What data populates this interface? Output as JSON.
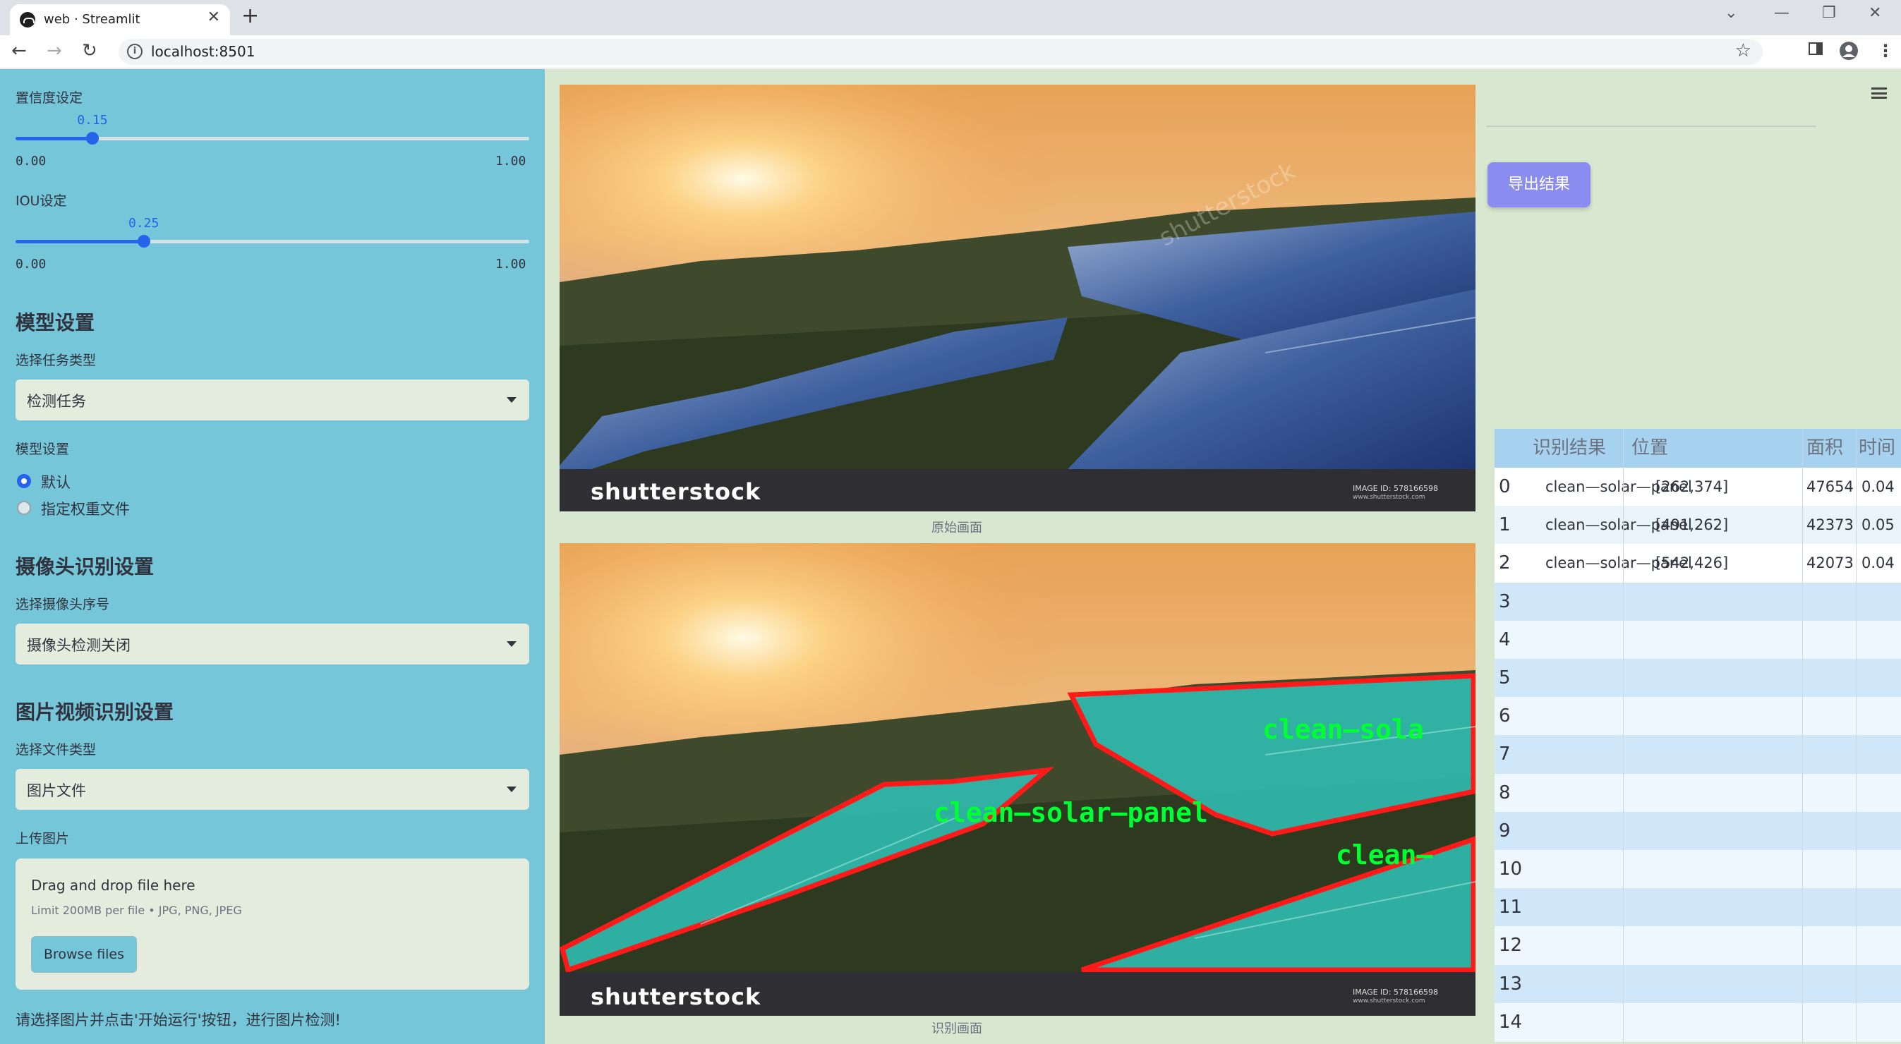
{
  "browser": {
    "tab_title": "web · Streamlit",
    "url": "localhost:8501",
    "close_glyph": "✕",
    "newtab_glyph": "+",
    "back_glyph": "←",
    "forward_glyph": "→",
    "reload_glyph": "↻",
    "star_glyph": "☆",
    "minimize_glyph": "—",
    "restore_glyph": "❐",
    "winclose_glyph": "✕",
    "expand_glyph": "⌄"
  },
  "sidebar": {
    "confidence": {
      "label": "置信度设定",
      "value": "0.15",
      "value_fraction": 0.15,
      "min": "0.00",
      "max": "1.00"
    },
    "iou": {
      "label": "IOU设定",
      "value": "0.25",
      "value_fraction": 0.25,
      "min": "0.00",
      "max": "1.00"
    },
    "model_section": {
      "title": "模型设置",
      "task_label": "选择任务类型",
      "task_value": "检测任务",
      "model_label": "模型设置",
      "options": [
        {
          "label": "默认",
          "selected": true
        },
        {
          "label": "指定权重文件",
          "selected": false
        }
      ]
    },
    "camera_section": {
      "title": "摄像头识别设置",
      "label": "选择摄像头序号",
      "value": "摄像头检测关闭"
    },
    "media_section": {
      "title": "图片视频识别设置",
      "file_type_label": "选择文件类型",
      "file_type_value": "图片文件",
      "upload_label": "上传图片",
      "drop_text": "Drag and drop file here",
      "limit_text": "Limit 200MB per file • JPG, PNG, JPEG",
      "browse_label": "Browse files"
    },
    "hint": "请选择图片并点击'开始运行'按钮，进行图片检测!"
  },
  "main": {
    "original_caption": "原始画面",
    "result_caption": "识别画面",
    "brand": "shutterstock",
    "image_id": "IMAGE ID: 578166598",
    "brand_site": "www.shutterstock.com",
    "watermark": "shutterstock",
    "detection_label": "clean—solar—panel",
    "detection_label_2": "clean—sola",
    "detection_label_3": "clean—",
    "export_label": "导出结果",
    "accent_color": "#2563eb",
    "sidebar_color": "#75c6d8",
    "box_color": "#ff1a1a",
    "label_color": "#00ff33"
  },
  "table": {
    "headers": [
      "识别结果",
      "位置",
      "面积",
      "时间"
    ],
    "rows": [
      {
        "idx": "0",
        "result": "clean—solar—panel",
        "pos": "[262,374]",
        "area": "47654",
        "time": "0.04"
      },
      {
        "idx": "1",
        "result": "clean—solar—panel",
        "pos": "[491,262]",
        "area": "42373",
        "time": "0.05"
      },
      {
        "idx": "2",
        "result": "clean—solar—panel",
        "pos": "[542,426]",
        "area": "42073",
        "time": "0.04"
      },
      {
        "idx": "3"
      },
      {
        "idx": "4"
      },
      {
        "idx": "5"
      },
      {
        "idx": "6"
      },
      {
        "idx": "7"
      },
      {
        "idx": "8"
      },
      {
        "idx": "9"
      },
      {
        "idx": "10"
      },
      {
        "idx": "11"
      },
      {
        "idx": "12"
      },
      {
        "idx": "13"
      },
      {
        "idx": "14"
      }
    ]
  }
}
